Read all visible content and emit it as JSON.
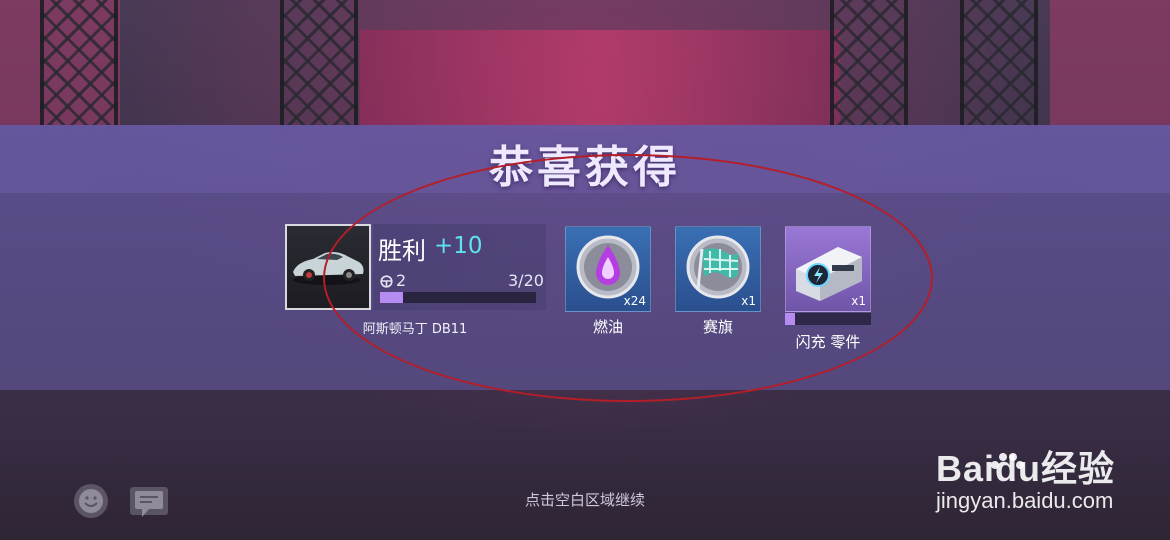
{
  "dialog": {
    "title": "恭喜获得",
    "continue_hint": "点击空白区域继续"
  },
  "car_reward": {
    "icon": "car-icon",
    "victory_label": "胜利",
    "victory_bonus": "+10",
    "level": "2",
    "progress_text": "3/20",
    "progress_fraction": 0.15,
    "car_name": "阿斯顿马丁 DB11"
  },
  "items": [
    {
      "name": "燃油",
      "count": "x24",
      "icon": "fuel-drop-icon"
    },
    {
      "name": "赛旗",
      "count": "x1",
      "icon": "race-flag-icon"
    },
    {
      "name": "闪充 零件",
      "count": "x1",
      "icon": "flash-charge-part-icon",
      "progress_fraction": 0.12
    }
  ],
  "chat": {
    "emoji_icon": "emoji-icon",
    "chat_icon": "chat-bubble-icon"
  },
  "watermark": {
    "brand_prefix": "Bai",
    "brand_mid": "du",
    "brand_suffix": "经验",
    "url": "jingyan.baidu.com"
  },
  "colors": {
    "accent_cyan": "#5fe3f0",
    "progress_purple": "#b68cf2",
    "annotation_red": "#b41e28"
  }
}
